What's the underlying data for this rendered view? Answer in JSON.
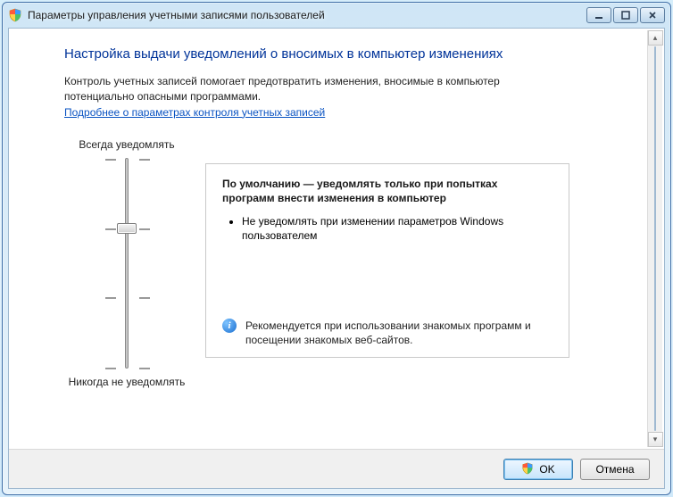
{
  "window": {
    "title": "Параметры управления учетными записями пользователей"
  },
  "content": {
    "heading": "Настройка выдачи уведомлений о вносимых в компьютер изменениях",
    "intro": "Контроль учетных записей помогает предотвратить изменения, вносимые в компьютер потенциально опасными программами.",
    "link": "Подробнее о параметрах контроля учетных записей"
  },
  "slider": {
    "top_label": "Всегда уведомлять",
    "bottom_label": "Никогда не уведомлять",
    "level_count": 4,
    "current_level": 2
  },
  "desc": {
    "title": "По умолчанию — уведомлять только при попытках программ внести изменения в компьютер",
    "bullets": [
      "Не уведомлять при изменении параметров Windows пользователем"
    ],
    "info": "Рекомендуется при использовании знакомых программ и посещении знакомых веб-сайтов."
  },
  "buttons": {
    "ok": "OK",
    "cancel": "Отмена"
  }
}
